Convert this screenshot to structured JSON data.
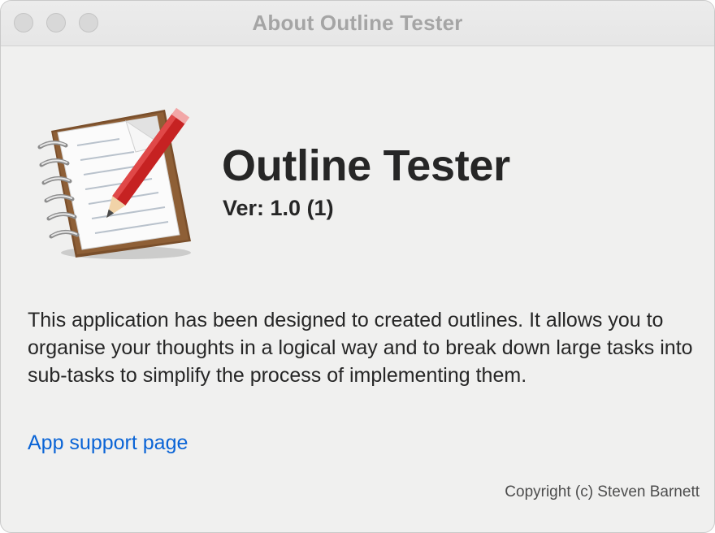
{
  "window": {
    "title": "About Outline Tester"
  },
  "app": {
    "name": "Outline Tester",
    "version": "Ver: 1.0 (1)",
    "icon": "notepad-pencil-icon"
  },
  "description": "This application has been designed to created outlines. It allows you to organise your thoughts in a logical way and to break down large tasks into sub-tasks to simplify the process of implementing them.",
  "support_link": {
    "label": "App support page"
  },
  "copyright": "Copyright (c) Steven Barnett",
  "colors": {
    "background": "#f0f0ef",
    "link": "#0a64d6",
    "title_text": "#a5a5a5",
    "heading_text": "#262626"
  }
}
